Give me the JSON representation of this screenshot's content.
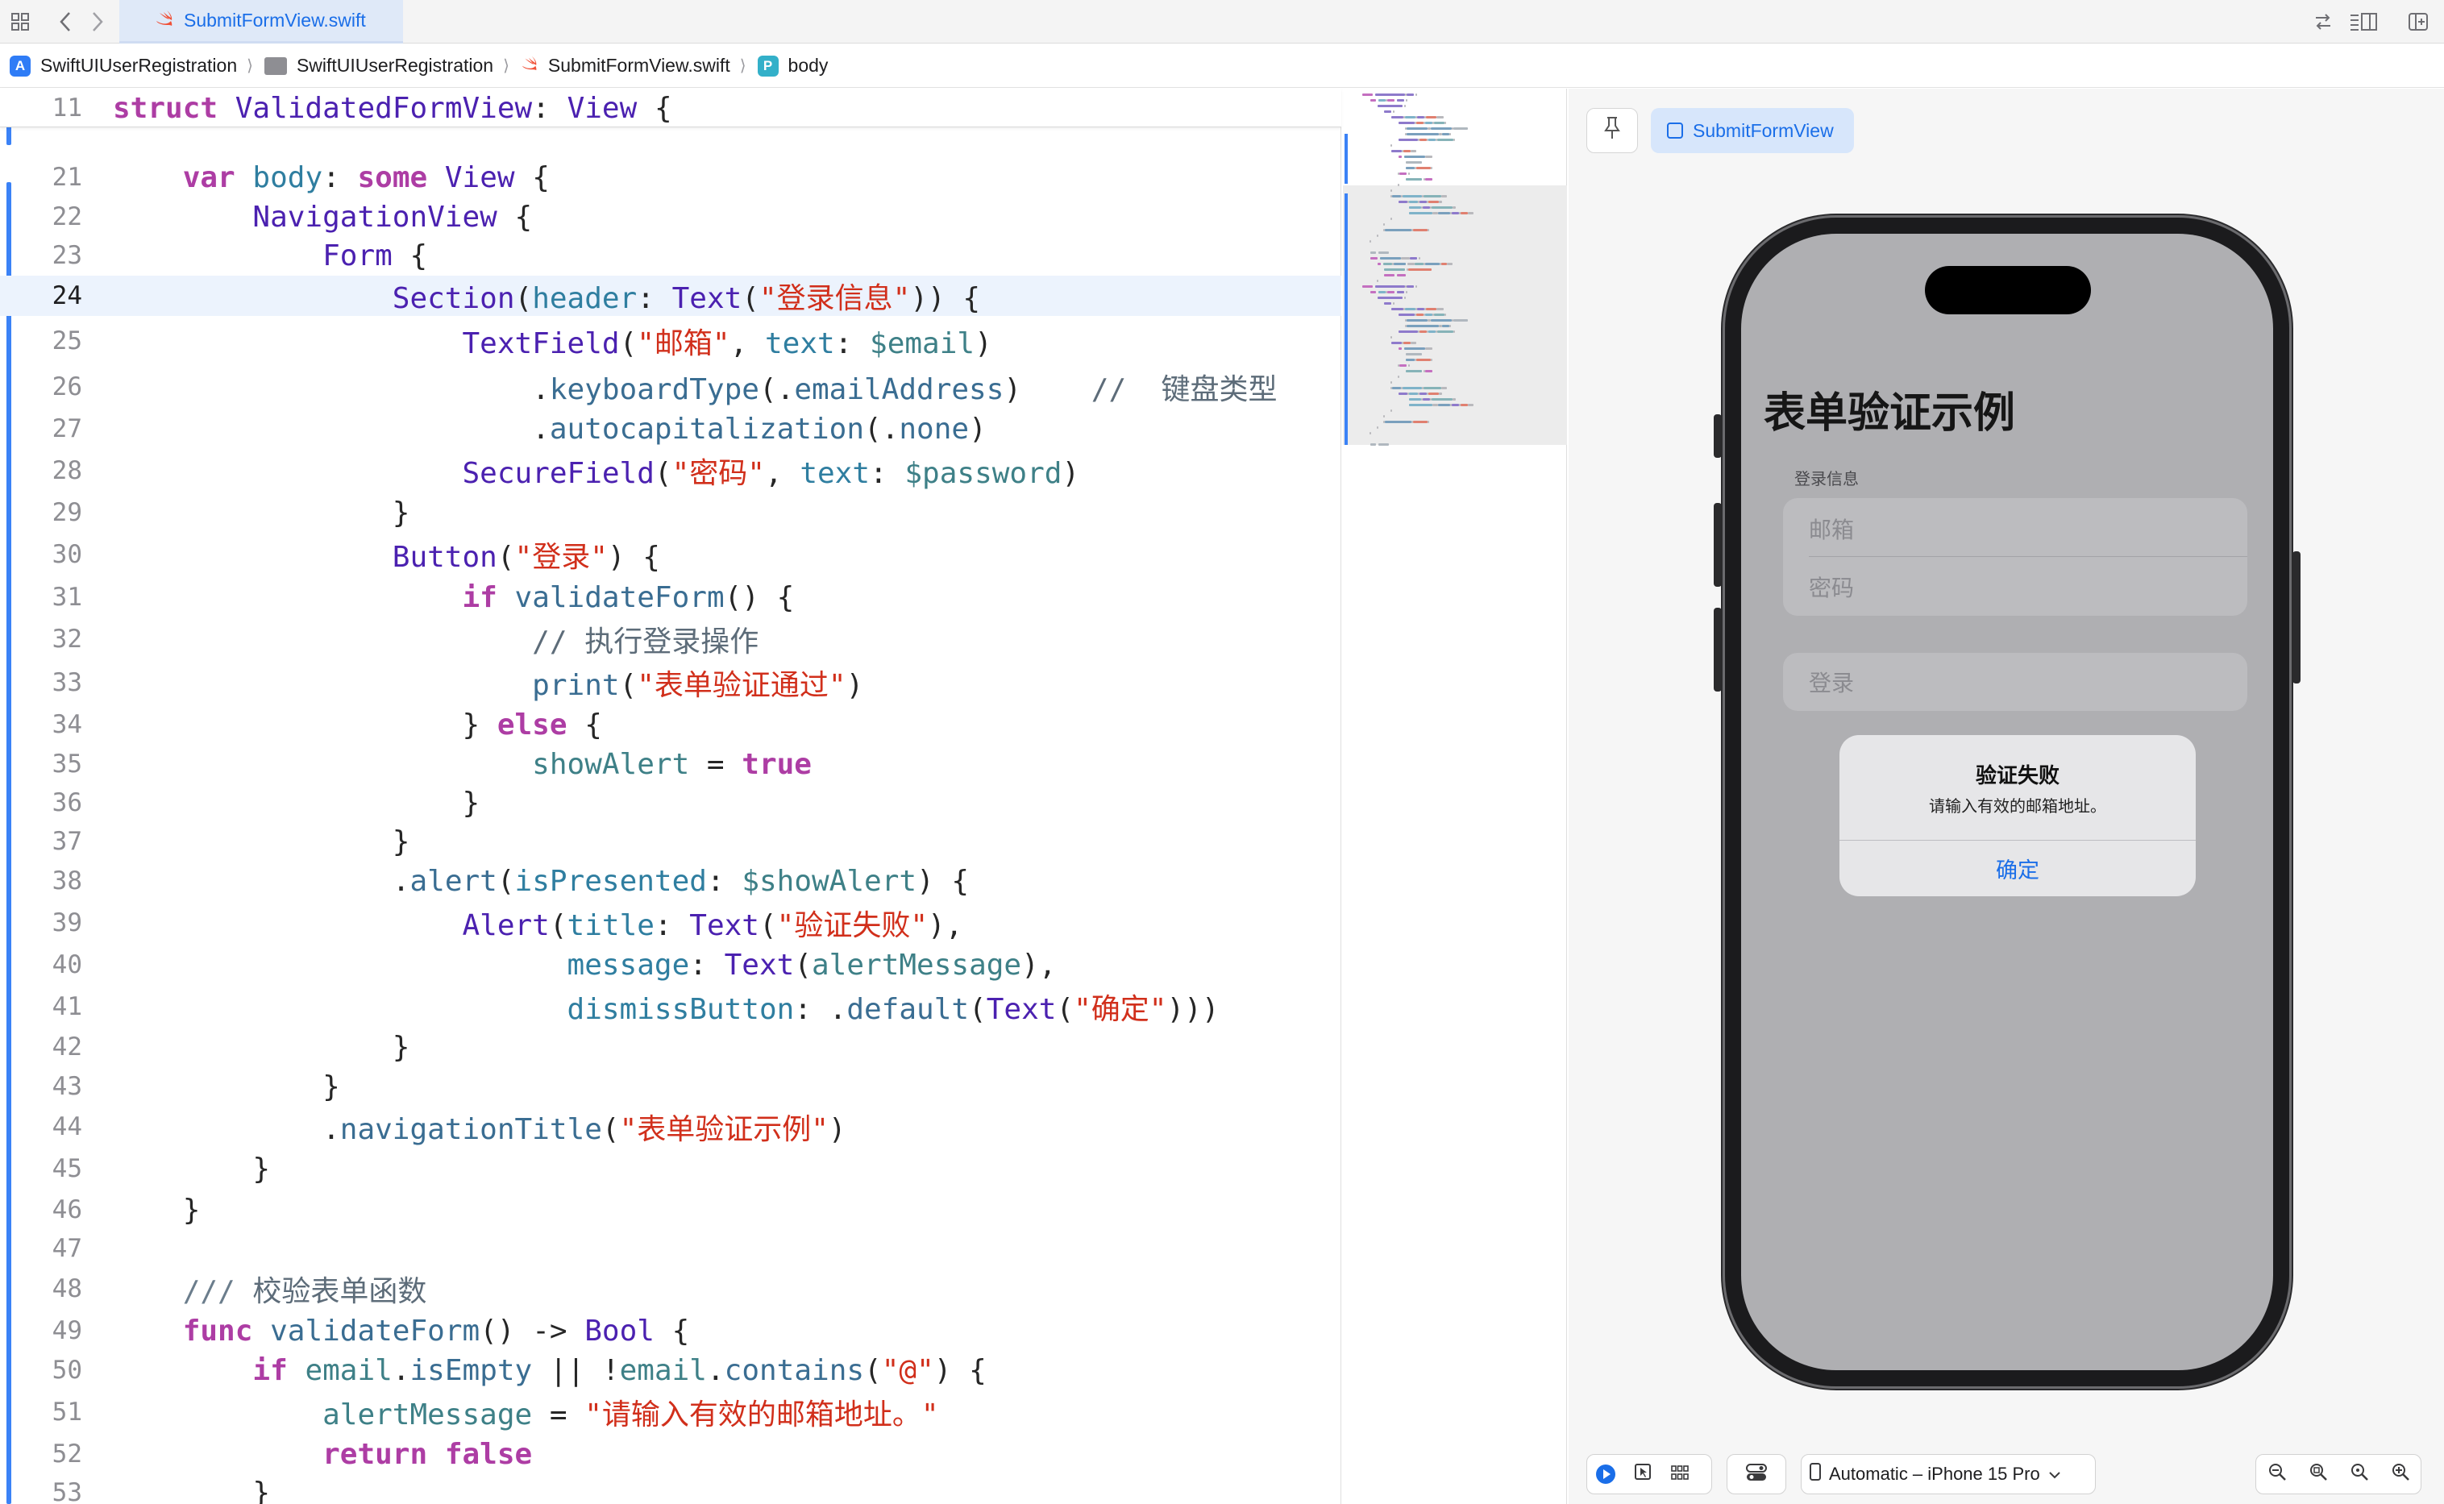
{
  "tabbar": {
    "active_tab": "SubmitFormView.swift",
    "icons": [
      "grid-icon",
      "back-chevron-icon",
      "forward-chevron-icon",
      "swap-icon",
      "inspector-layout-icon",
      "add-editor-icon"
    ]
  },
  "breadcrumb": {
    "project": "SwiftUIUserRegistration",
    "folder": "SwiftUIUserRegistration",
    "file": "SubmitFormView.swift",
    "symbol_badge": "P",
    "symbol": "body",
    "separator": "⟩"
  },
  "editor": {
    "sticky": {
      "num": "11",
      "code": [
        [
          "kw",
          "struct"
        ],
        [
          "p",
          " "
        ],
        [
          "ty",
          "ValidatedFormView"
        ],
        [
          "p",
          ": "
        ],
        [
          "ty",
          "View"
        ],
        [
          "p",
          " {"
        ]
      ]
    },
    "current_line": "24",
    "lines": [
      {
        "num": "21",
        "code": [
          [
            "p",
            "    "
          ],
          [
            "kw",
            "var"
          ],
          [
            "p",
            " "
          ],
          [
            "pr",
            "body"
          ],
          [
            "p",
            ": "
          ],
          [
            "kw",
            "some"
          ],
          [
            "p",
            " "
          ],
          [
            "ty",
            "View"
          ],
          [
            "p",
            " {"
          ]
        ]
      },
      {
        "num": "22",
        "code": [
          [
            "p",
            "        "
          ],
          [
            "ty",
            "NavigationView"
          ],
          [
            "p",
            " {"
          ]
        ]
      },
      {
        "num": "23",
        "code": [
          [
            "p",
            "            "
          ],
          [
            "ty",
            "Form"
          ],
          [
            "p",
            " {"
          ]
        ]
      },
      {
        "num": "24",
        "code": [
          [
            "p",
            "                "
          ],
          [
            "ty",
            "Section"
          ],
          [
            "p",
            "("
          ],
          [
            "pr",
            "header"
          ],
          [
            "p",
            ": "
          ],
          [
            "ty",
            "Text"
          ],
          [
            "p",
            "("
          ],
          [
            "st",
            "\"登录信息\""
          ],
          [
            "p",
            ")) {"
          ]
        ]
      },
      {
        "num": "25",
        "code": [
          [
            "p",
            "                    "
          ],
          [
            "ty",
            "TextField"
          ],
          [
            "p",
            "("
          ],
          [
            "st",
            "\"邮箱\""
          ],
          [
            "p",
            ", "
          ],
          [
            "pr",
            "text"
          ],
          [
            "p",
            ": "
          ],
          [
            "vr",
            "$email"
          ],
          [
            "p",
            ")"
          ]
        ]
      },
      {
        "num": "26",
        "code": [
          [
            "p",
            "                        ."
          ],
          [
            "fn",
            "keyboardType"
          ],
          [
            "p",
            "(."
          ],
          [
            "fn",
            "emailAddress"
          ],
          [
            "p",
            ")    "
          ],
          [
            "cm",
            "//  键盘类型"
          ]
        ]
      },
      {
        "num": "27",
        "code": [
          [
            "p",
            "                        ."
          ],
          [
            "fn",
            "autocapitalization"
          ],
          [
            "p",
            "(."
          ],
          [
            "fn",
            "none"
          ],
          [
            "p",
            ")"
          ]
        ]
      },
      {
        "num": "28",
        "code": [
          [
            "p",
            "                    "
          ],
          [
            "ty",
            "SecureField"
          ],
          [
            "p",
            "("
          ],
          [
            "st",
            "\"密码\""
          ],
          [
            "p",
            ", "
          ],
          [
            "pr",
            "text"
          ],
          [
            "p",
            ": "
          ],
          [
            "vr",
            "$password"
          ],
          [
            "p",
            ")"
          ]
        ]
      },
      {
        "num": "29",
        "code": [
          [
            "p",
            "                }"
          ]
        ]
      },
      {
        "num": "30",
        "code": [
          [
            "p",
            "                "
          ],
          [
            "ty",
            "Button"
          ],
          [
            "p",
            "("
          ],
          [
            "st",
            "\"登录\""
          ],
          [
            "p",
            ") {"
          ]
        ]
      },
      {
        "num": "31",
        "code": [
          [
            "p",
            "                    "
          ],
          [
            "kw",
            "if"
          ],
          [
            "p",
            " "
          ],
          [
            "fn",
            "validateForm"
          ],
          [
            "p",
            "() {"
          ]
        ]
      },
      {
        "num": "32",
        "code": [
          [
            "p",
            "                        "
          ],
          [
            "cm",
            "// 执行登录操作"
          ]
        ]
      },
      {
        "num": "33",
        "code": [
          [
            "p",
            "                        "
          ],
          [
            "fn",
            "print"
          ],
          [
            "p",
            "("
          ],
          [
            "st",
            "\"表单验证通过\""
          ],
          [
            "p",
            ")"
          ]
        ]
      },
      {
        "num": "34",
        "code": [
          [
            "p",
            "                    } "
          ],
          [
            "kw",
            "else"
          ],
          [
            "p",
            " {"
          ]
        ]
      },
      {
        "num": "35",
        "code": [
          [
            "p",
            "                        "
          ],
          [
            "vr",
            "showAlert"
          ],
          [
            "p",
            " = "
          ],
          [
            "kw",
            "true"
          ]
        ]
      },
      {
        "num": "36",
        "code": [
          [
            "p",
            "                    }"
          ]
        ]
      },
      {
        "num": "37",
        "code": [
          [
            "p",
            "                }"
          ]
        ]
      },
      {
        "num": "38",
        "code": [
          [
            "p",
            "                ."
          ],
          [
            "fn",
            "alert"
          ],
          [
            "p",
            "("
          ],
          [
            "pr",
            "isPresented"
          ],
          [
            "p",
            ": "
          ],
          [
            "vr",
            "$showAlert"
          ],
          [
            "p",
            ") {"
          ]
        ]
      },
      {
        "num": "39",
        "code": [
          [
            "p",
            "                    "
          ],
          [
            "ty",
            "Alert"
          ],
          [
            "p",
            "("
          ],
          [
            "pr",
            "title"
          ],
          [
            "p",
            ": "
          ],
          [
            "ty",
            "Text"
          ],
          [
            "p",
            "("
          ],
          [
            "st",
            "\"验证失败\""
          ],
          [
            "p",
            "),"
          ]
        ]
      },
      {
        "num": "40",
        "code": [
          [
            "p",
            "                          "
          ],
          [
            "pr",
            "message"
          ],
          [
            "p",
            ": "
          ],
          [
            "ty",
            "Text"
          ],
          [
            "p",
            "("
          ],
          [
            "vr",
            "alertMessage"
          ],
          [
            "p",
            "),"
          ]
        ]
      },
      {
        "num": "41",
        "code": [
          [
            "p",
            "                          "
          ],
          [
            "pr",
            "dismissButton"
          ],
          [
            "p",
            ": ."
          ],
          [
            "fn",
            "default"
          ],
          [
            "p",
            "("
          ],
          [
            "ty",
            "Text"
          ],
          [
            "p",
            "("
          ],
          [
            "st",
            "\"确定\""
          ],
          [
            "p",
            ")))"
          ]
        ]
      },
      {
        "num": "42",
        "code": [
          [
            "p",
            "                }"
          ]
        ]
      },
      {
        "num": "43",
        "code": [
          [
            "p",
            "            }"
          ]
        ]
      },
      {
        "num": "44",
        "code": [
          [
            "p",
            "            ."
          ],
          [
            "fn",
            "navigationTitle"
          ],
          [
            "p",
            "("
          ],
          [
            "st",
            "\"表单验证示例\""
          ],
          [
            "p",
            ")"
          ]
        ]
      },
      {
        "num": "45",
        "code": [
          [
            "p",
            "        }"
          ]
        ]
      },
      {
        "num": "46",
        "code": [
          [
            "p",
            "    }"
          ]
        ]
      },
      {
        "num": "47",
        "code": []
      },
      {
        "num": "48",
        "code": [
          [
            "p",
            "    "
          ],
          [
            "cmd",
            "///"
          ],
          [
            "p",
            " "
          ],
          [
            "cm",
            "校验表单函数"
          ]
        ]
      },
      {
        "num": "49",
        "code": [
          [
            "p",
            "    "
          ],
          [
            "kw",
            "func"
          ],
          [
            "p",
            " "
          ],
          [
            "fn",
            "validateForm"
          ],
          [
            "p",
            "() -> "
          ],
          [
            "ty",
            "Bool"
          ],
          [
            "p",
            " {"
          ]
        ]
      },
      {
        "num": "50",
        "code": [
          [
            "p",
            "        "
          ],
          [
            "kw",
            "if"
          ],
          [
            "p",
            " "
          ],
          [
            "vr",
            "email"
          ],
          [
            "p",
            "."
          ],
          [
            "fn",
            "isEmpty"
          ],
          [
            "p",
            " || !"
          ],
          [
            "vr",
            "email"
          ],
          [
            "p",
            "."
          ],
          [
            "fn",
            "contains"
          ],
          [
            "p",
            "("
          ],
          [
            "st",
            "\"@\""
          ],
          [
            "p",
            ") {"
          ]
        ]
      },
      {
        "num": "51",
        "code": [
          [
            "p",
            "            "
          ],
          [
            "vr",
            "alertMessage"
          ],
          [
            "p",
            " = "
          ],
          [
            "st",
            "\"请输入有效的邮箱地址。\""
          ]
        ]
      },
      {
        "num": "52",
        "code": [
          [
            "p",
            "            "
          ],
          [
            "kw",
            "return"
          ],
          [
            "p",
            " "
          ],
          [
            "kw",
            "false"
          ]
        ]
      },
      {
        "num": "53",
        "code": [
          [
            "p",
            "        }"
          ]
        ]
      }
    ]
  },
  "canvas": {
    "preview_chip": "SubmitFormView",
    "device": "Automatic – iPhone 15 Pro",
    "app": {
      "nav_title": "表单验证示例",
      "section_header": "登录信息",
      "email_placeholder": "邮箱",
      "password_placeholder": "密码",
      "login_button": "登录",
      "alert_title": "验证失败",
      "alert_message": "请输入有效的邮箱地址。",
      "alert_button": "确定"
    }
  },
  "colors": {
    "keyword": "#ad3da4",
    "type": "#4b21b0",
    "function": "#3a6d92",
    "string": "#d12f1b",
    "accent": "#1a6ee8"
  }
}
